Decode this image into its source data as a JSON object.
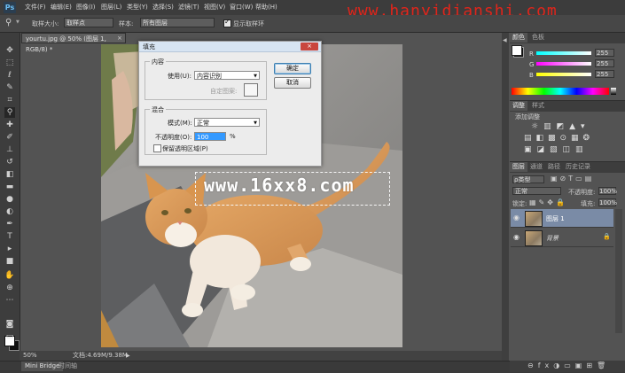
{
  "app": {
    "logo": "Ps"
  },
  "menu": [
    "文件(F)",
    "编辑(E)",
    "图像(I)",
    "图层(L)",
    "类型(Y)",
    "选择(S)",
    "滤镜(T)",
    "视图(V)",
    "窗口(W)",
    "帮助(H)"
  ],
  "watermark_top": "www.hanyidianshi.com",
  "options": {
    "size_label": "取样大小:",
    "size_value": "取样点",
    "sample_label": "样本:",
    "sample_value": "所有图层",
    "show_ring_label": "显示取样环"
  },
  "document": {
    "tab_title": "yourtu.jpg @ 50% (图层 1, RGB/8) *",
    "close": "×"
  },
  "status": {
    "zoom": "50%",
    "doc_info": "文档:4.69M/9.38M"
  },
  "bottom_tabs": {
    "mini_bridge": "Mini Bridge",
    "timeline": "时间轴"
  },
  "overlay_text": "www.16xx8.com",
  "fill_dialog": {
    "title": "填充",
    "close": "×",
    "content_group": "内容",
    "use_label": "使用(U):",
    "use_value": "内容识别",
    "custom_pattern_label": "自定图案:",
    "blend_group": "混合",
    "mode_label": "模式(M):",
    "mode_value": "正常",
    "opacity_label": "不透明度(O):",
    "opacity_value": "100",
    "opacity_unit": "%",
    "preserve_label": "保留透明区域(P)",
    "ok_label": "确定",
    "cancel_label": "取消"
  },
  "color_panel": {
    "tabs": [
      "颜色",
      "色板"
    ],
    "r_value": "255",
    "g_value": "255",
    "b_value": "255",
    "r_label": "R",
    "g_label": "G",
    "b_label": "B"
  },
  "adjust_panel": {
    "tabs": [
      "调整",
      "样式"
    ],
    "hint": "添加调整"
  },
  "layers_panel": {
    "tabs": [
      "图层",
      "通道",
      "路径",
      "历史记录"
    ],
    "kind_value": "ρ类型",
    "blend_value": "正常",
    "opacity_label": "不透明度:",
    "opacity_value": "100%",
    "lock_label": "锁定:",
    "fill_label": "填充:",
    "fill_value": "100%",
    "layers": [
      {
        "name": "图层 1",
        "selected": true
      },
      {
        "name": "背景",
        "selected": false,
        "italic": true
      }
    ]
  },
  "colors": {
    "accent": "#3399ff",
    "close_red": "#c9463d",
    "watermark_red": "#e0251b"
  }
}
